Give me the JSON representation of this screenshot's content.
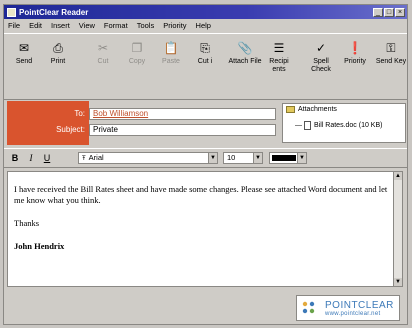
{
  "window": {
    "title": "PointClear Reader"
  },
  "menu": [
    "File",
    "Edit",
    "Insert",
    "View",
    "Format",
    "Tools",
    "Priority",
    "Help"
  ],
  "toolbar": [
    {
      "label": "Send",
      "icon": "send-icon",
      "enabled": true
    },
    {
      "label": "Print",
      "icon": "printer-icon",
      "enabled": true
    },
    {
      "label": "Cut",
      "icon": "scissors-icon",
      "enabled": false
    },
    {
      "label": "Copy",
      "icon": "copy-icon",
      "enabled": false
    },
    {
      "label": "Paste",
      "icon": "paste-icon",
      "enabled": false
    },
    {
      "label": "Cut i",
      "icon": "cut-i-icon",
      "enabled": true
    },
    {
      "label": "Attach File",
      "icon": "paperclip-icon",
      "enabled": true
    },
    {
      "label": "Recipi ents",
      "icon": "recipients-icon",
      "enabled": true
    },
    {
      "label": "Spell Check",
      "icon": "spell-check-icon",
      "enabled": true
    },
    {
      "label": "Priority",
      "icon": "priority-icon",
      "enabled": true
    },
    {
      "label": "Send Key",
      "icon": "key-icon",
      "enabled": true
    }
  ],
  "header": {
    "to_label": "To:",
    "to_value": "Bob Williamson",
    "subject_label": "Subject:",
    "subject_value": "Private"
  },
  "attachments": {
    "title": "Attachments",
    "items": [
      "Bill Rates.doc (10 KB)"
    ]
  },
  "format": {
    "bold": "B",
    "italic": "I",
    "underline": "U",
    "font": "Arial",
    "size": "10",
    "color": "#000000"
  },
  "body": {
    "paragraphs": [
      "I have received the Bill Rates sheet and have made some changes. Please see attached Word document and let me know what you think.",
      "Thanks"
    ],
    "signature": "John Hendrix"
  },
  "logo": {
    "title": "POINTCLEAR",
    "url": "www.pointclear.net"
  },
  "colors": {
    "title_bar": "#1e2896",
    "header_panel": "#d9542e",
    "link": "#c0502d",
    "logo": "#3c79b8"
  }
}
